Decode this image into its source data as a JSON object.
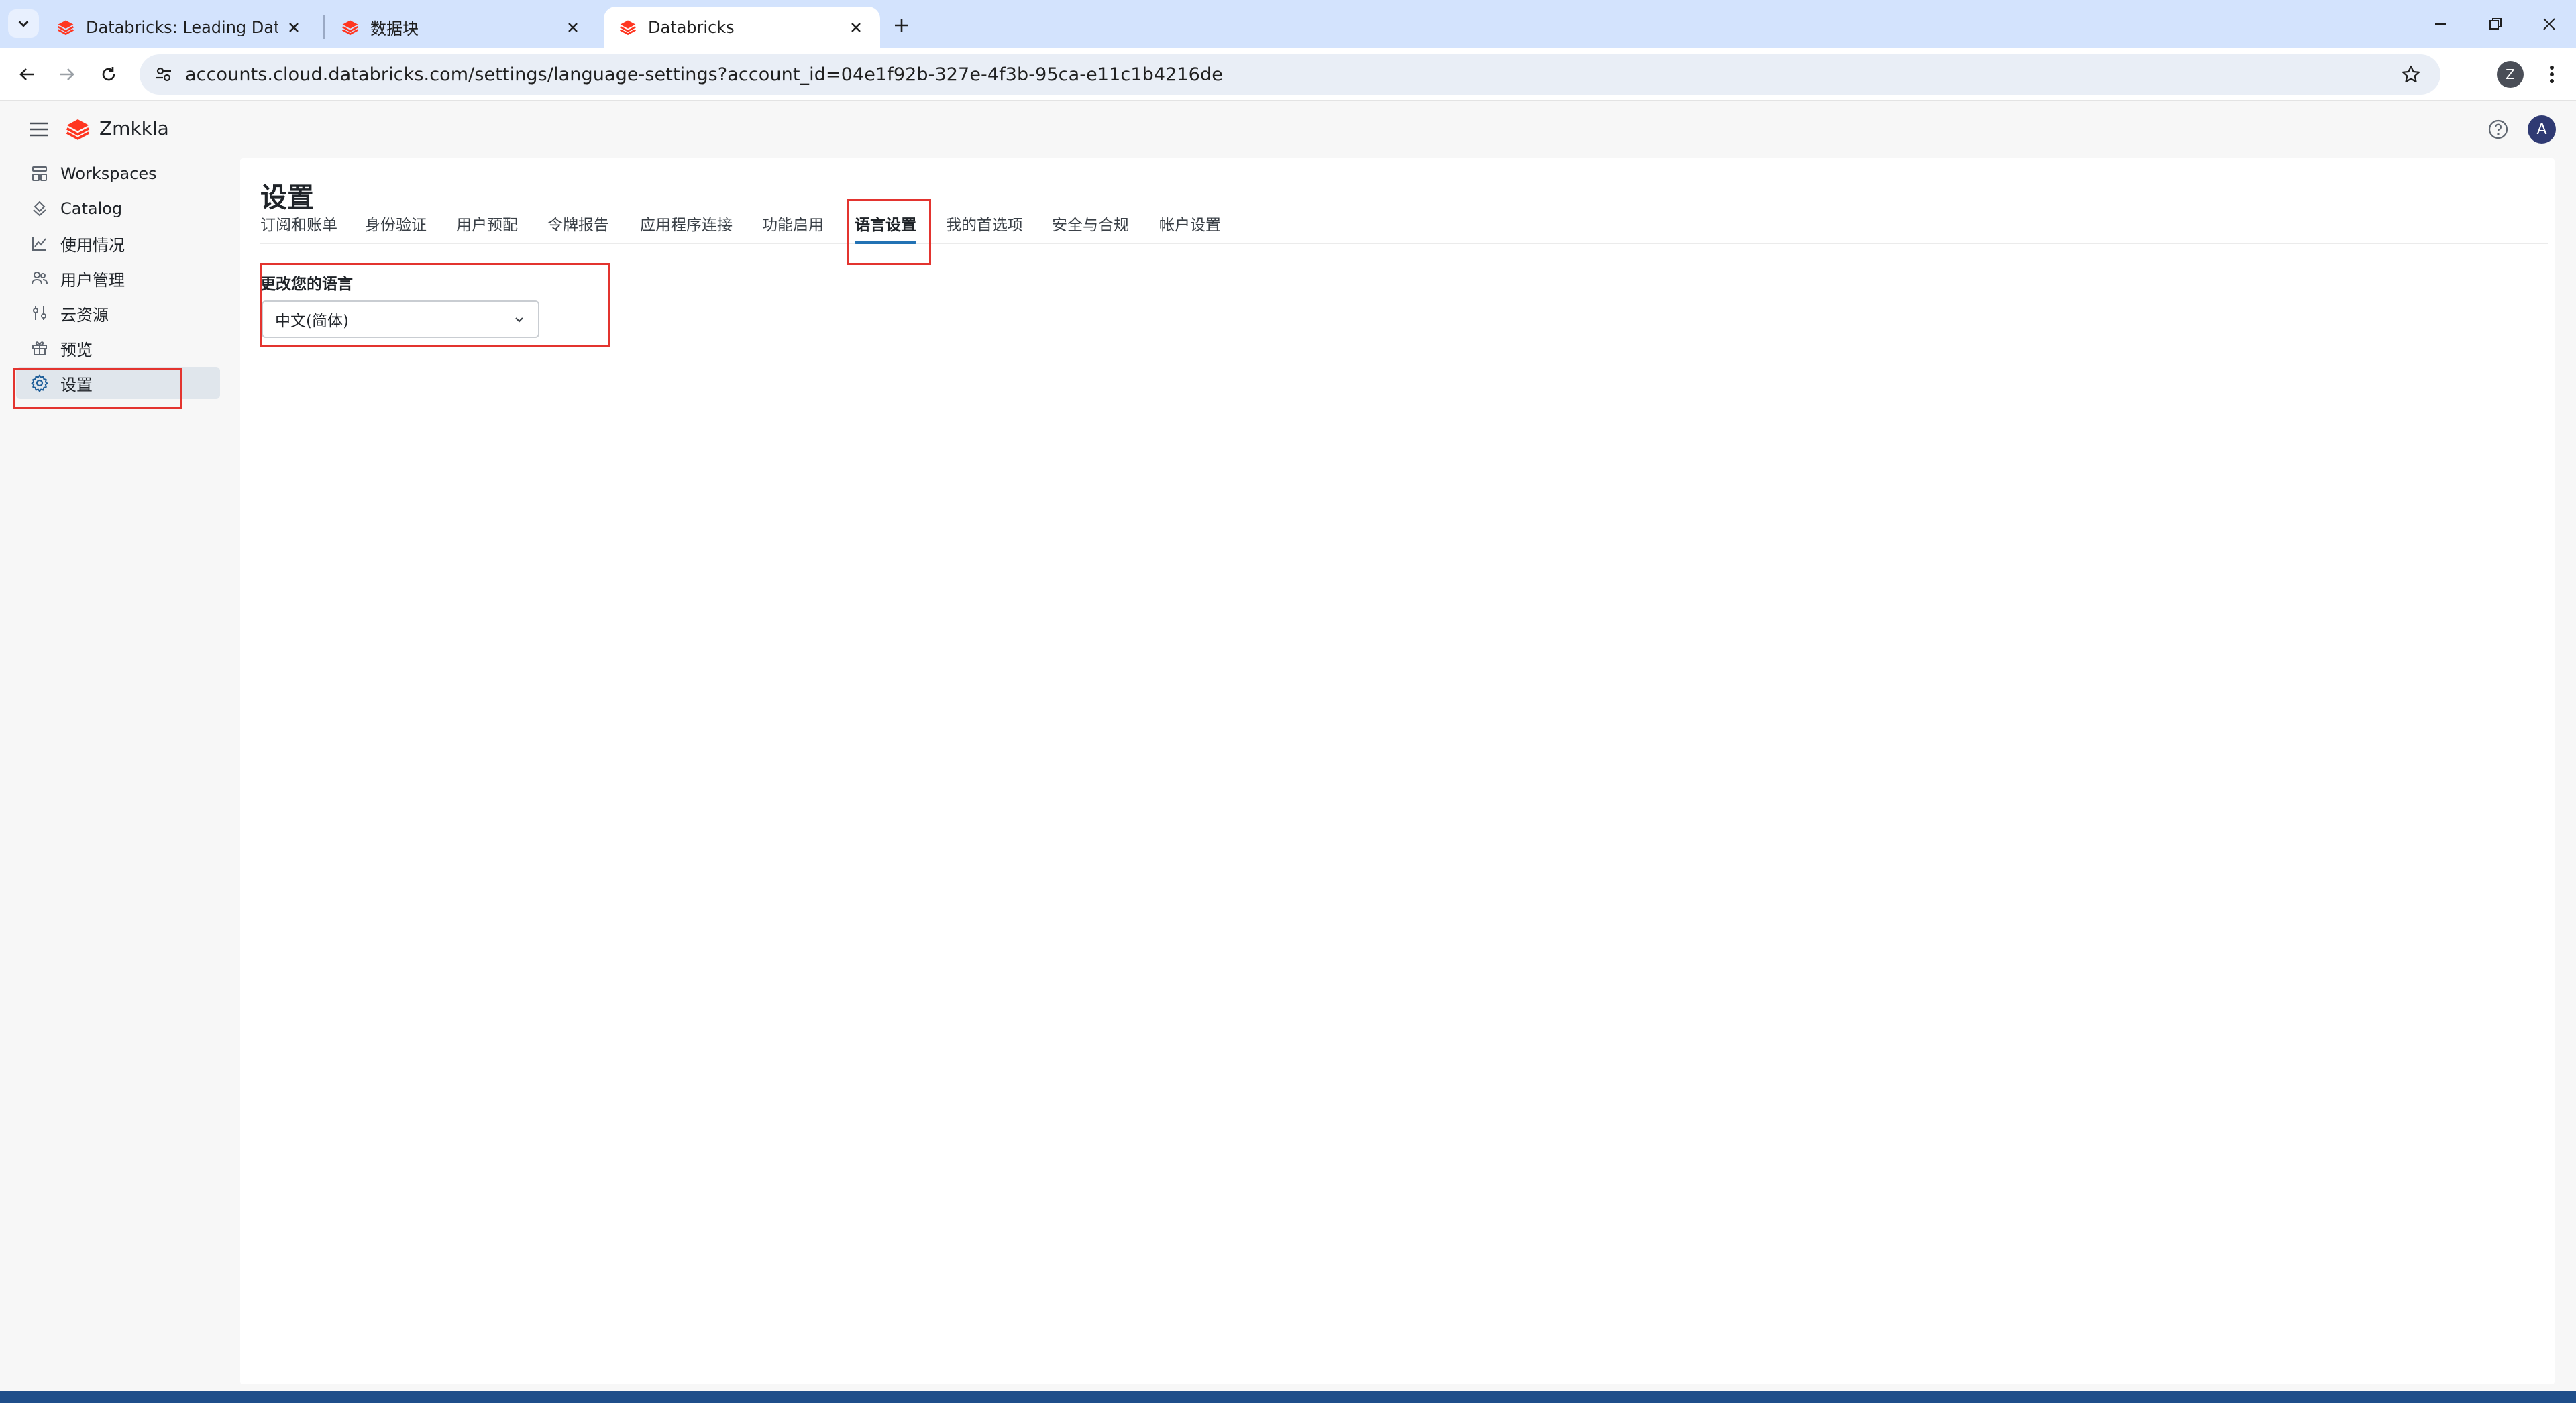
{
  "browser": {
    "tabs": [
      {
        "title": "Databricks: Leading Data and",
        "active": false
      },
      {
        "title": "数据块",
        "active": false
      },
      {
        "title": "Databricks",
        "active": true
      }
    ],
    "url": "accounts.cloud.databricks.com/settings/language-settings?account_id=04e1f92b-327e-4f3b-95ca-e11c1b4216de",
    "profile_initial": "Z"
  },
  "app": {
    "workspace_name": "Zmkkla",
    "user_initial": "A"
  },
  "sidebar": {
    "items": [
      {
        "label": "Workspaces",
        "icon": "workspaces-icon",
        "active": false
      },
      {
        "label": "Catalog",
        "icon": "catalog-icon",
        "active": false
      },
      {
        "label": "使用情况",
        "icon": "usage-chart-icon",
        "active": false
      },
      {
        "label": "用户管理",
        "icon": "users-icon",
        "active": false
      },
      {
        "label": "云资源",
        "icon": "cloud-resources-icon",
        "active": false
      },
      {
        "label": "预览",
        "icon": "gift-icon",
        "active": false
      },
      {
        "label": "设置",
        "icon": "gear-icon",
        "active": true
      }
    ]
  },
  "page": {
    "title": "设置",
    "tabs": [
      {
        "label": "订阅和账单",
        "active": false
      },
      {
        "label": "身份验证",
        "active": false
      },
      {
        "label": "用户预配",
        "active": false
      },
      {
        "label": "令牌报告",
        "active": false
      },
      {
        "label": "应用程序连接",
        "active": false
      },
      {
        "label": "功能启用",
        "active": false
      },
      {
        "label": "语言设置",
        "active": true
      },
      {
        "label": "我的首选项",
        "active": false
      },
      {
        "label": "安全与合规",
        "active": false
      },
      {
        "label": "帐户设置",
        "active": false
      }
    ],
    "language": {
      "label": "更改您的语言",
      "selected": "中文(简体)"
    }
  },
  "colors": {
    "accent": "#2272b4",
    "brand": "#ff3621",
    "highlight": "#e3342f",
    "tabbar": "#d3e3fd"
  }
}
